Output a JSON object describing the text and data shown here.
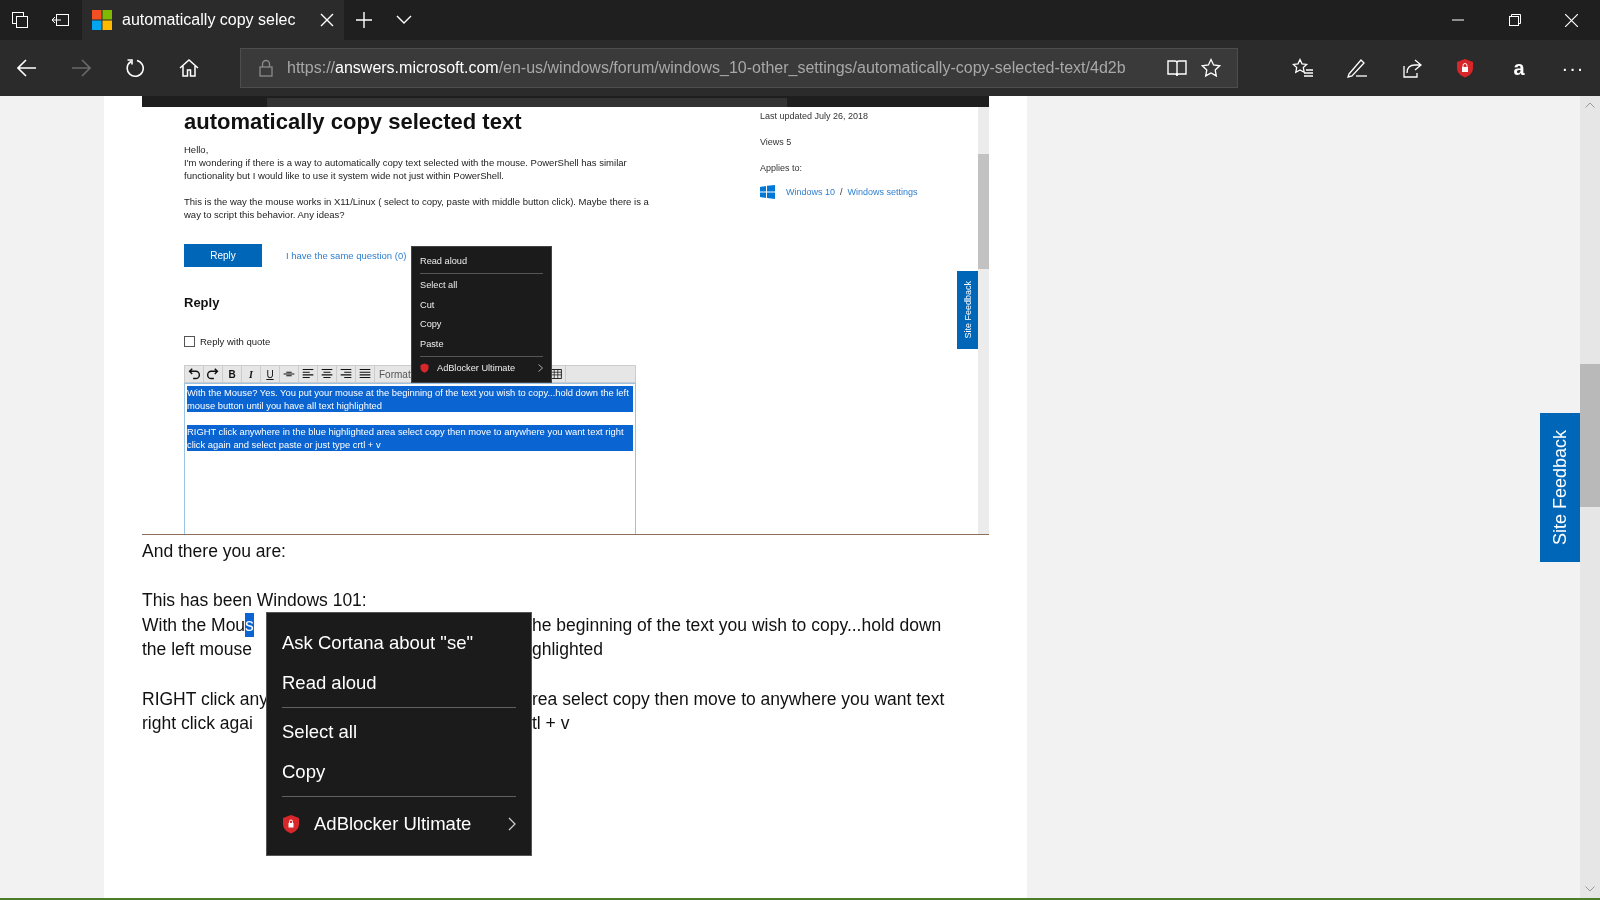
{
  "browser": {
    "tabs": [
      {
        "title": "automatically copy selec",
        "selected": true
      }
    ],
    "address": {
      "scheme": "https://",
      "host": "answers.microsoft.com",
      "path": "/en-us/windows/forum/windows_10-other_settings/automatically-copy-selected-text/4d2b"
    },
    "back_disabled": false,
    "forward_disabled": true,
    "extension_label": "a",
    "more_label": "···"
  },
  "embedded_screenshot": {
    "title": "automatically copy selected text",
    "paragraphs": [
      "Hello,",
      "I'm wondering if there is a way to automatically copy text selected with the mouse. PowerShell has similar functionality but I would like to use it system wide not just within PowerShell.",
      "This is the way the mouse works in X11/Linux ( select to copy, paste with middle button click). Maybe there is a way to script this behavior. Any ideas?"
    ],
    "reply_button": "Reply",
    "same_question_link": "I have the same question (0)",
    "reply_heading": "Reply",
    "quote_checkbox": {
      "label": "Reply with quote",
      "checked": false
    },
    "toolbar": [
      {
        "kind": "undo"
      },
      {
        "kind": "redo"
      },
      {
        "kind": "letter",
        "label": "B"
      },
      {
        "kind": "letter",
        "label": "I"
      },
      {
        "kind": "letter",
        "label": "U"
      },
      {
        "kind": "strike"
      },
      {
        "kind": "alignleft"
      },
      {
        "kind": "aligncenter"
      },
      {
        "kind": "alignright"
      },
      {
        "kind": "justify"
      },
      {
        "kind": "text",
        "label": "Format"
      },
      {
        "kind": "table"
      }
    ],
    "editor_paragraphs": [
      {
        "text": "With the Mouse?  Yes. You put your mouse at the beginning of the text you wish to copy...hold down the left mouse button until you have all text highlighted",
        "selected": true
      },
      {
        "text": "RIGHT click anywhere in the blue highlighted area select copy then move to anywhere you want text right click again and select paste or just type crtl + v",
        "selected": true
      }
    ],
    "meta": {
      "updated": "Last updated July 26, 2018",
      "views": "Views 5",
      "applies_label": "Applies to:",
      "links": [
        "Windows 10",
        "Windows settings"
      ],
      "separator": "/"
    },
    "feedback": "Site Feedback",
    "context_menu": [
      {
        "kind": "item",
        "label": "Read aloud"
      },
      {
        "kind": "separator"
      },
      {
        "kind": "item",
        "label": "Select all"
      },
      {
        "kind": "item",
        "label": "Cut"
      },
      {
        "kind": "item",
        "label": "Copy"
      },
      {
        "kind": "item",
        "label": "Paste"
      },
      {
        "kind": "separator"
      },
      {
        "kind": "submenu",
        "label": "AdBlocker Ultimate"
      }
    ]
  },
  "article": [
    {
      "kind": "text",
      "left": "And there you are:"
    },
    {
      "kind": "blank"
    },
    {
      "kind": "text",
      "left": "This has been Windows 101:"
    },
    {
      "kind": "split",
      "left": "With the Mou",
      "selected_fragment": "s",
      "right": "he beginning of the text you wish to copy...hold down"
    },
    {
      "kind": "split",
      "left": "the left mouse",
      "right": "ghlighted"
    },
    {
      "kind": "blank"
    },
    {
      "kind": "split",
      "left": "RIGHT click any",
      "right": "rea select copy then move to anywhere you want text"
    },
    {
      "kind": "split",
      "left": "right click agai",
      "right": "tl + v"
    }
  ],
  "context_menu": [
    {
      "kind": "item",
      "label": "Ask Cortana about \"se\""
    },
    {
      "kind": "item",
      "label": "Read aloud"
    },
    {
      "kind": "separator"
    },
    {
      "kind": "item",
      "label": "Select all"
    },
    {
      "kind": "item",
      "label": "Copy"
    },
    {
      "kind": "separator"
    },
    {
      "kind": "submenu",
      "label": "AdBlocker Ultimate"
    }
  ],
  "site_feedback": "Site Feedback"
}
